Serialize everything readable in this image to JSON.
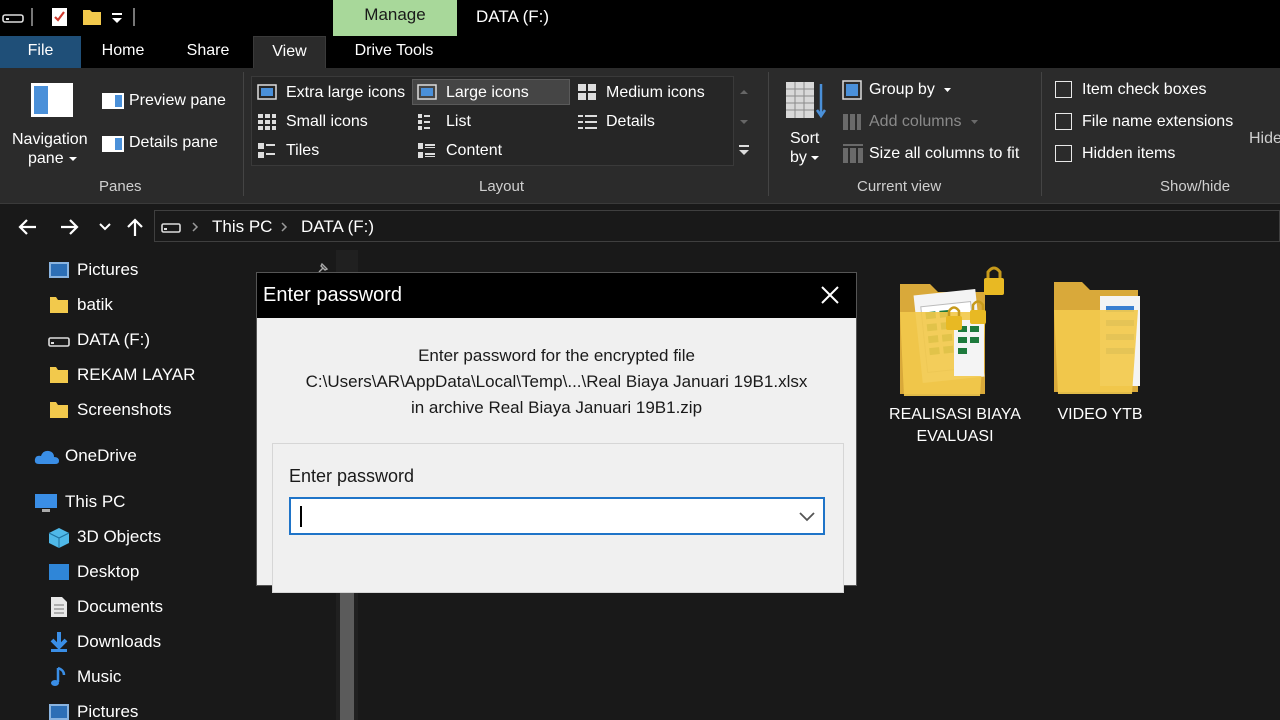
{
  "window": {
    "manage_tab": "Manage",
    "title": "DATA (F:)"
  },
  "ribbon_tabs": [
    "File",
    "Home",
    "Share",
    "View",
    "Drive Tools"
  ],
  "ribbon": {
    "panes": {
      "navigation_pane_line1": "Navigation",
      "navigation_pane_line2": "pane",
      "preview_pane": "Preview pane",
      "details_pane": "Details pane",
      "group_label": "Panes"
    },
    "layout": {
      "extra_large_icons": "Extra large icons",
      "large_icons": "Large icons",
      "medium_icons": "Medium icons",
      "small_icons": "Small icons",
      "list": "List",
      "details": "Details",
      "tiles": "Tiles",
      "content": "Content",
      "selected": "Large icons",
      "group_label": "Layout"
    },
    "current_view": {
      "sort_by_line1": "Sort",
      "sort_by_line2": "by",
      "group_by": "Group by",
      "add_columns": "Add columns",
      "size_all_columns": "Size all columns to fit",
      "group_label": "Current view"
    },
    "show_hide": {
      "item_check_boxes": "Item check boxes",
      "file_name_extensions": "File name extensions",
      "hidden_items": "Hidden items",
      "hide_selected": "Hide",
      "group_label": "Show/hide"
    }
  },
  "address": {
    "crumbs": [
      "This PC",
      "DATA (F:)"
    ]
  },
  "sidebar": {
    "items": [
      "Pictures",
      "batik",
      "DATA (F:)",
      "REKAM LAYAR",
      "Screenshots",
      "OneDrive",
      "This PC",
      "3D Objects",
      "Desktop",
      "Documents",
      "Downloads",
      "Music",
      "Pictures"
    ]
  },
  "content": {
    "items": [
      {
        "line1": "REALISASI BIAYA",
        "line2": "EVALUASI"
      },
      {
        "line1": "VIDEO YTB",
        "line2": ""
      }
    ]
  },
  "dialog": {
    "title": "Enter password",
    "message_line1": "Enter password for the encrypted file",
    "message_line2": "C:\\Users\\AR\\AppData\\Local\\Temp\\...\\Real Biaya  Januari 19B1.xlsx",
    "message_line3": "in archive Real Biaya  Januari 19B1.zip",
    "field_label": "Enter password",
    "field_value": ""
  },
  "colors": {
    "manage_tab": "#a8d89a",
    "file_tab": "#1f4f78",
    "input_border": "#1f74c8",
    "folder": "#f2c94c"
  }
}
